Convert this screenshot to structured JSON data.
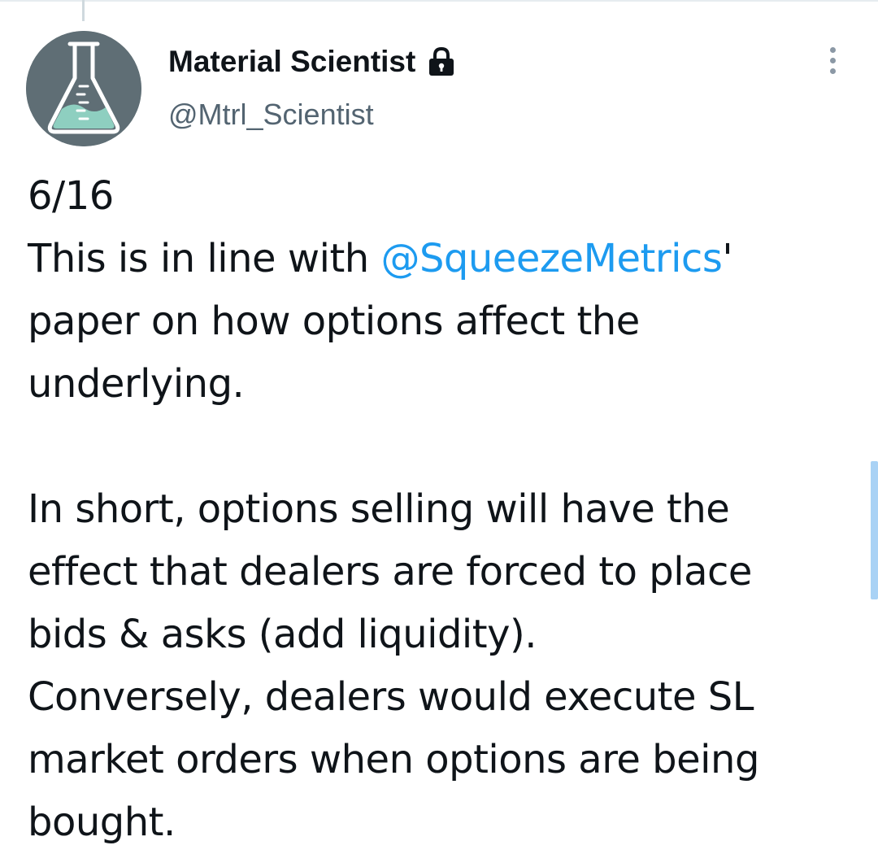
{
  "tweet": {
    "author": {
      "display_name": "Material Scientist",
      "handle": "@Mtrl_Scientist",
      "protected_icon": "lock-icon",
      "avatar_icon": "flask-icon"
    },
    "menu_icon": "more-vertical-icon",
    "text": {
      "line1": "6/16",
      "line2_prefix": "This is in line with ",
      "line2_mention": "@SqueezeMetrics",
      "line2_suffix": "'",
      "line3": "paper on how options affect the",
      "line4": "underlying.",
      "line6": "In short, options selling will have the",
      "line7": "effect that dealers are forced to place",
      "line8": "bids & asks (add liquidity).",
      "line9": "Conversely, dealers would execute SL",
      "line10": "market orders when options are being",
      "line11": "bought."
    }
  },
  "colors": {
    "text": "#0f1419",
    "secondary": "#536471",
    "link": "#1d9bf0",
    "avatar_bg": "#5f6e75",
    "avatar_liquid": "#8ecfc0"
  }
}
